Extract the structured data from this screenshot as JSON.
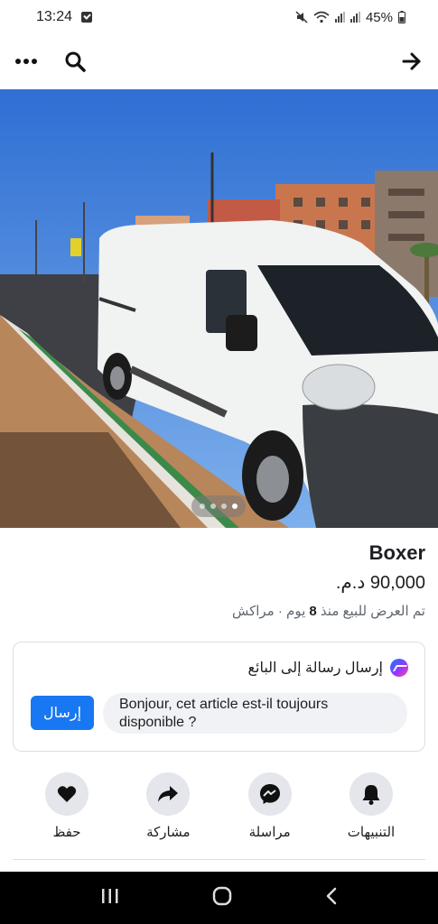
{
  "status_bar": {
    "time": "13:24",
    "battery": "45%"
  },
  "app_bar": {
    "more_icon": "more-horizontal-icon",
    "search_icon": "search-icon",
    "back_icon": "arrow-right-icon"
  },
  "listing": {
    "photo_alt": "",
    "carousel_count": 4,
    "carousel_active": 3,
    "title": "Boxer",
    "price": "90,000 د.م.",
    "meta_prefix": "تم العرض للبيع منذ ",
    "meta_days": "8",
    "meta_suffix": " يوم · مراكش"
  },
  "message": {
    "header": "إرسال رسالة إلى البائع",
    "input_value": "Bonjour, cet article est-il toujours disponible ?",
    "send_label": "إرسال"
  },
  "actions": [
    {
      "label": "التنبيهات",
      "icon": "bell-icon"
    },
    {
      "label": "مراسلة",
      "icon": "messenger-icon"
    },
    {
      "label": "مشاركة",
      "icon": "share-icon"
    },
    {
      "label": "حفظ",
      "icon": "heart-icon"
    }
  ],
  "colors": {
    "accent": "#1877f2",
    "button_bg": "#e4e6eb"
  }
}
